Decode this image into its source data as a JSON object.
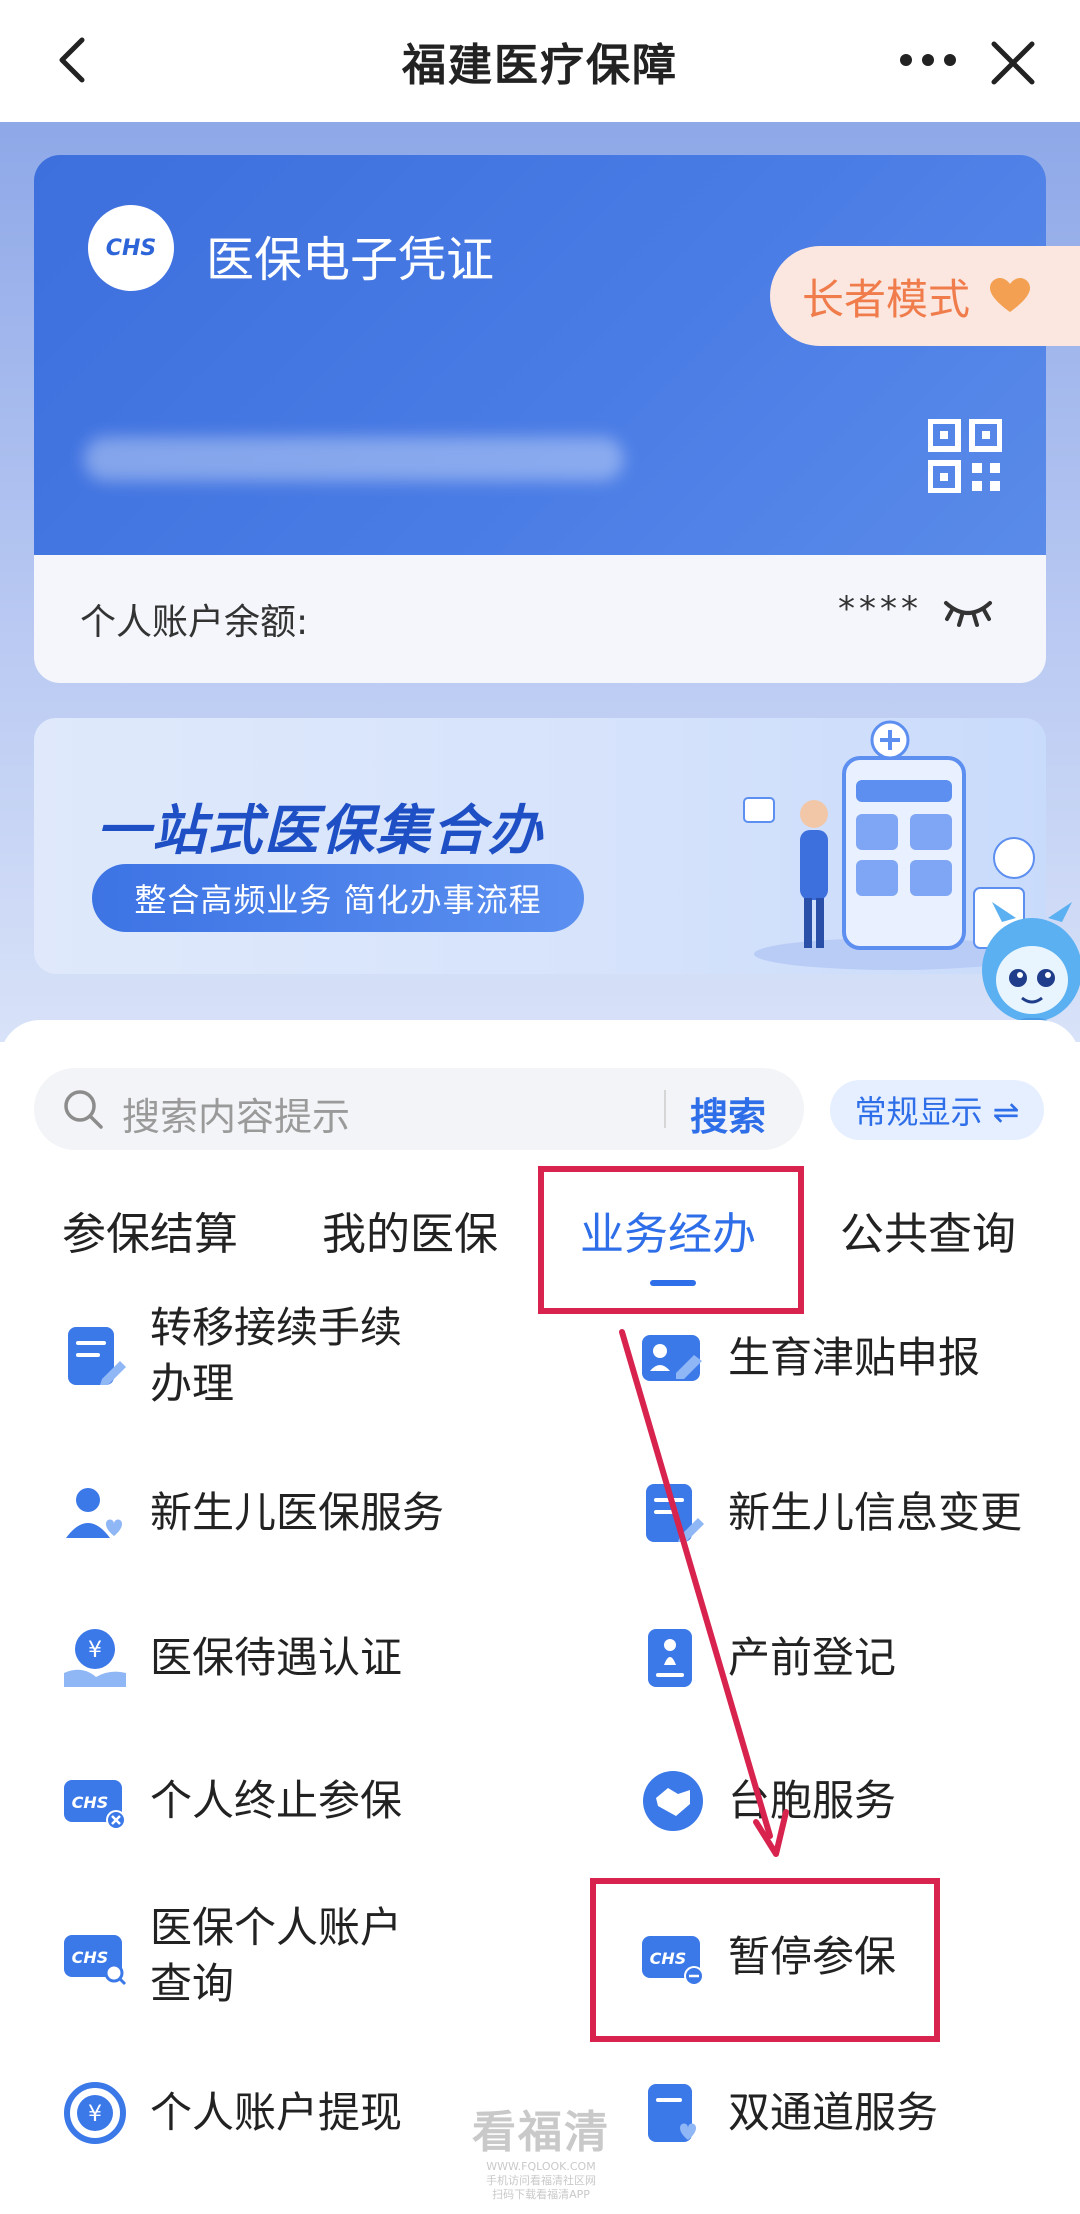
{
  "header": {
    "title": "福建医疗保障"
  },
  "card": {
    "logo_text": "CHS",
    "title": "医保电子凭证",
    "elder_mode": "长者模式",
    "balance_label": "个人账户余额:",
    "balance_masked": "****"
  },
  "banner": {
    "headline": "一站式医保集合办",
    "tagline": "整合高频业务 简化办事流程"
  },
  "search": {
    "placeholder": "搜索内容提示",
    "button": "搜索"
  },
  "display_mode": "常规显示 ⇌",
  "tabs": [
    {
      "label": "参保结算",
      "active": false
    },
    {
      "label": "我的医保",
      "active": false
    },
    {
      "label": "业务经办",
      "active": true
    },
    {
      "label": "公共查询",
      "active": false
    }
  ],
  "services": [
    {
      "label_line1": "转移接续手续",
      "label_line2": "办理",
      "icon": "document-edit-icon"
    },
    {
      "label_line1": "生育津贴申报",
      "label_line2": "",
      "icon": "maternity-allowance-icon"
    },
    {
      "label_line1": "新生儿医保服务",
      "label_line2": "",
      "icon": "newborn-user-icon"
    },
    {
      "label_line1": "新生儿信息变更",
      "label_line2": "",
      "icon": "info-change-icon"
    },
    {
      "label_line1": "医保待遇认证",
      "label_line2": "",
      "icon": "benefit-certify-icon"
    },
    {
      "label_line1": "产前登记",
      "label_line2": "",
      "icon": "prenatal-register-icon"
    },
    {
      "label_line1": "个人终止参保",
      "label_line2": "",
      "icon": "chs-terminate-icon"
    },
    {
      "label_line1": "台胞服务",
      "label_line2": "",
      "icon": "handshake-icon"
    },
    {
      "label_line1": "医保个人账户",
      "label_line2": "查询",
      "icon": "chs-search-icon"
    },
    {
      "label_line1": "暂停参保",
      "label_line2": "",
      "icon": "chs-pause-icon"
    },
    {
      "label_line1": "个人账户提现",
      "label_line2": "",
      "icon": "yuan-withdraw-icon"
    },
    {
      "label_line1": "双通道服务",
      "label_line2": "",
      "icon": "dual-channel-icon"
    }
  ],
  "watermark": {
    "title": "看福清",
    "url": "WWW.FQLOOK.COM",
    "line1": "手机访问看福清社区网",
    "line2": "扫码下载看福清APP"
  },
  "colors": {
    "accent": "#2e6ee8",
    "card_blue": "#3d6fdd",
    "highlight_red": "#d8234f",
    "elder_orange": "#f07c4c"
  }
}
